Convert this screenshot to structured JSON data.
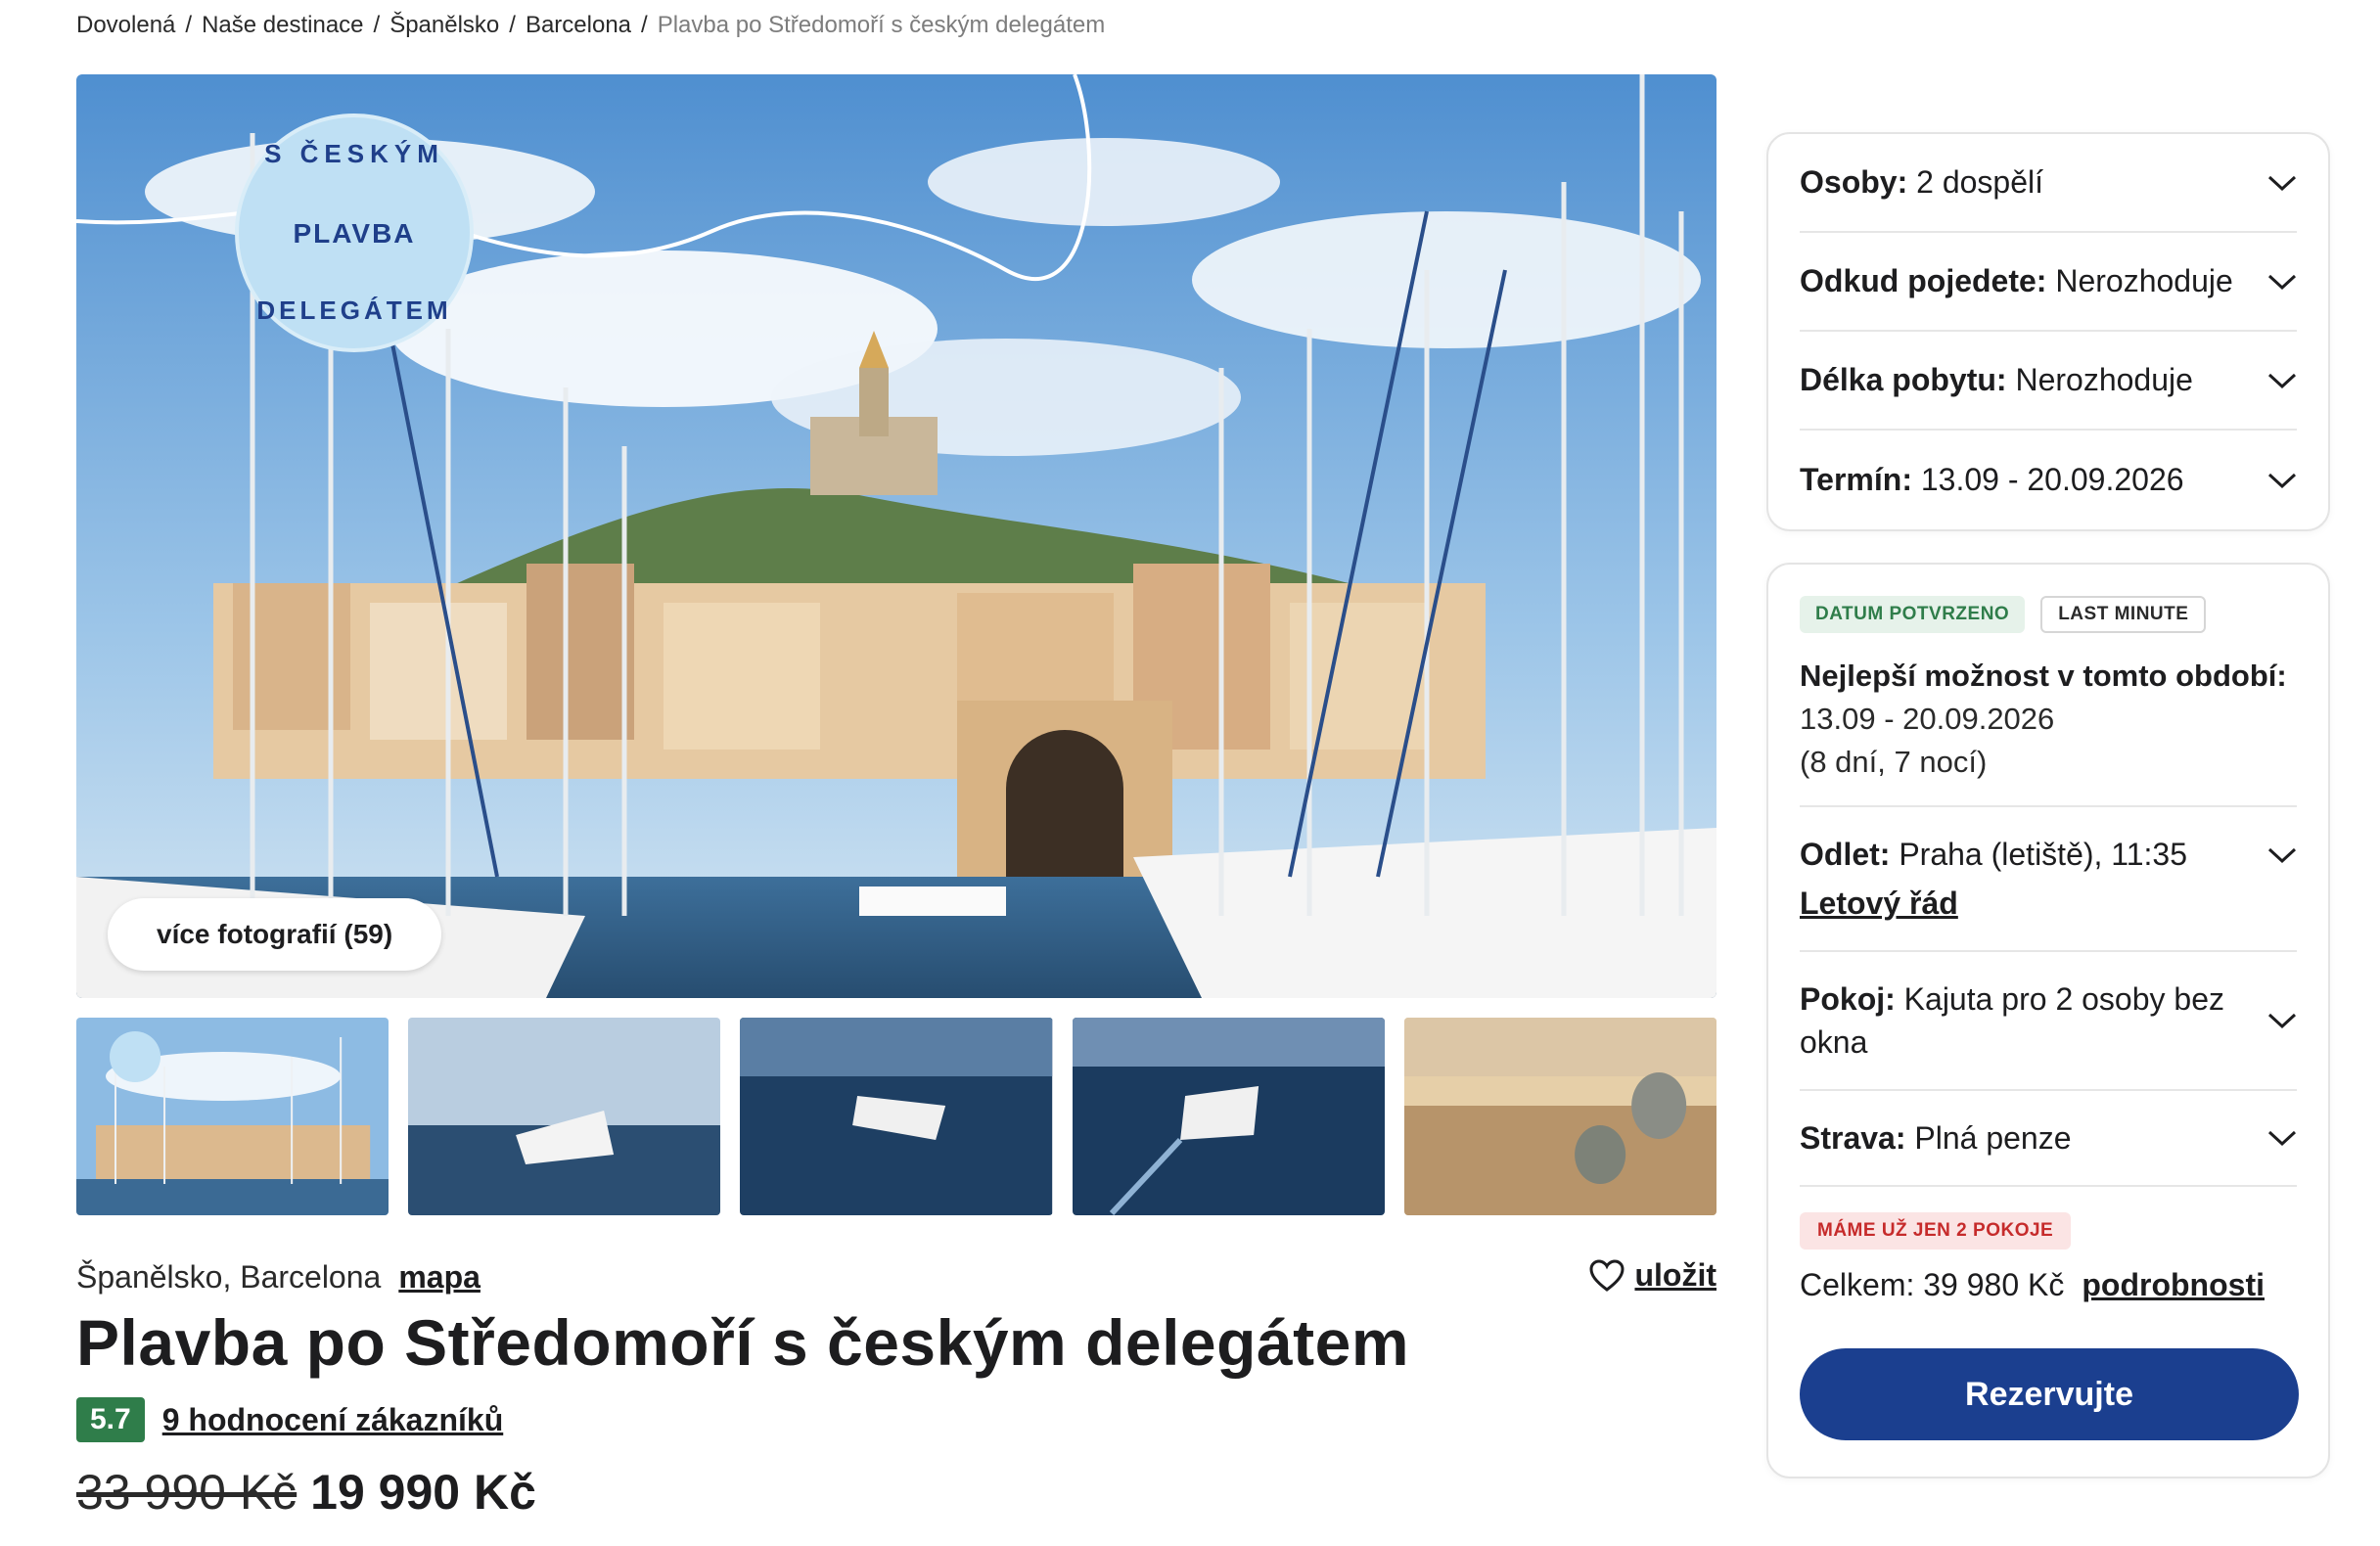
{
  "breadcrumb": {
    "items": [
      "Dovolená",
      "Naše destinace",
      "Španělsko",
      "Barcelona"
    ],
    "current": "Plavba po Středomoří s českým delegátem",
    "separator": "/"
  },
  "gallery": {
    "badge_top": "S ČESKÝM",
    "badge_mid": "PLAVBA",
    "badge_bottom": "DELEGÁTEM",
    "more_photos_label": "více fotografií (59)"
  },
  "details": {
    "location": "Španělsko, Barcelona",
    "map_link": "mapa",
    "save_label": "uložit",
    "title": "Plavba po Středomoří s českým delegátem",
    "rating": "5.7",
    "reviews_link": "9 hodnocení zákazníků",
    "old_price": "33 990 Kč",
    "new_price": "19 990 Kč"
  },
  "options": {
    "persons_label": "Osoby:",
    "persons_value": "2 dospělí",
    "from_label": "Odkud pojedete:",
    "from_value": "Nerozhoduje",
    "length_label": "Délka pobytu:",
    "length_value": "Nerozhoduje",
    "date_label": "Termín:",
    "date_value": "13.09 - 20.09.2026"
  },
  "offer": {
    "tag_confirmed": "DATUM POTVRZENO",
    "tag_last_minute": "LAST MINUTE",
    "best_title": "Nejlepší možnost v tomto období:",
    "best_dates": "13.09 - 20.09.2026",
    "best_duration": "(8 dní, 7 nocí)",
    "flight_label": "Odlet:",
    "flight_value": "Praha (letiště), 11:35",
    "flight_link": "Letový řád",
    "room_label": "Pokoj:",
    "room_value": "Kajuta pro 2 osoby bez okna",
    "meal_label": "Strava:",
    "meal_value": "Plná penze",
    "warning": "MÁME UŽ JEN 2 POKOJE",
    "total": "Celkem: 39 980 Kč",
    "details_link": "podrobnosti",
    "reserve_label": "Rezervujte"
  },
  "colors": {
    "primary_button": "#1b3f8f",
    "rating_badge": "#2f7d4a",
    "tag_green_bg": "#e6f2ea",
    "warning_bg": "#fbe4e4",
    "warning_text": "#c62b2b"
  },
  "icons": {
    "save": "heart-icon",
    "dropdown": "chevron-down-icon"
  }
}
